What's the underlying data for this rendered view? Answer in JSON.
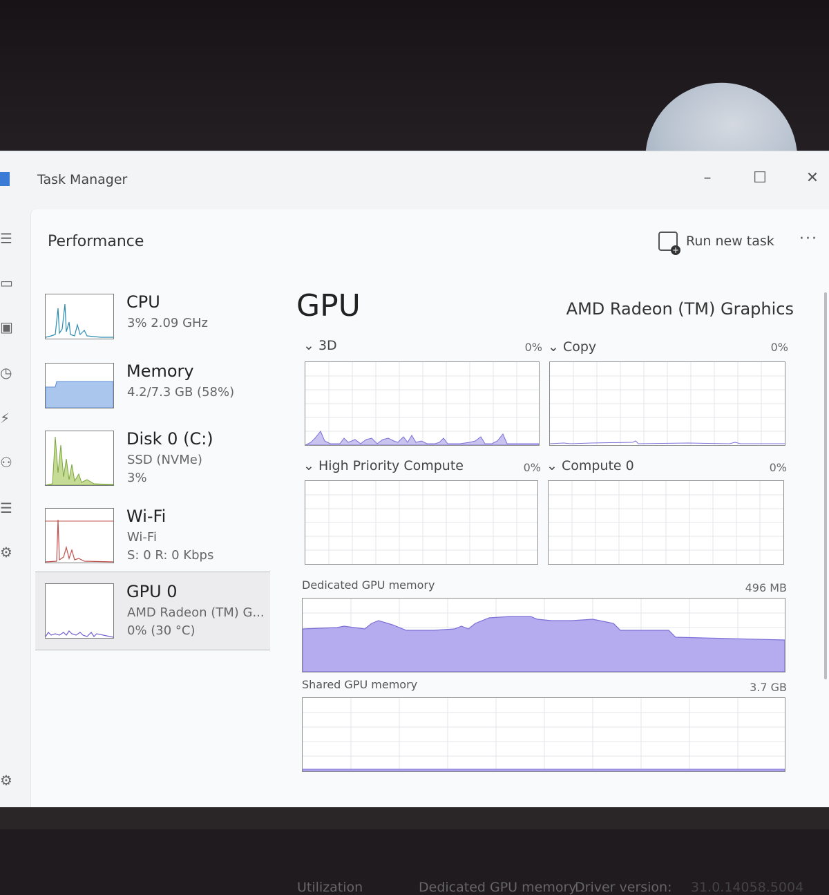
{
  "window": {
    "title": "Task Manager",
    "controls": {
      "minimize": "–",
      "maximize": "☐",
      "close": "✕"
    }
  },
  "header": {
    "page_title": "Performance",
    "run_new_task": "Run new task",
    "more": "···"
  },
  "nav_rail": [
    "menu-icon",
    "processes-icon",
    "performance-icon",
    "history-icon",
    "startup-icon",
    "users-icon",
    "details-icon",
    "services-icon",
    "settings-icon"
  ],
  "resources": [
    {
      "name": "CPU",
      "sub1": "3% 2.09 GHz",
      "sub2": "",
      "color": "#2b8cb1"
    },
    {
      "name": "Memory",
      "sub1": "4.2/7.3 GB (58%)",
      "sub2": "",
      "color": "#5c8fd6"
    },
    {
      "name": "Disk 0 (C:)",
      "sub1": "SSD (NVMe)",
      "sub2": "3%",
      "color": "#7aa43a"
    },
    {
      "name": "Wi-Fi",
      "sub1": "Wi-Fi",
      "sub2": "S: 0 R: 0 Kbps",
      "color": "#c0504d"
    },
    {
      "name": "GPU 0",
      "sub1": "AMD Radeon (TM) G...",
      "sub2": "0% (30 °C)",
      "color": "#6f5fd0"
    }
  ],
  "gpu": {
    "title": "GPU",
    "model": "AMD Radeon (TM) Graphics",
    "engines": [
      {
        "label": "3D",
        "percent": "0%"
      },
      {
        "label": "Copy",
        "percent": "0%"
      },
      {
        "label": "High Priority Compute",
        "percent": "0%"
      },
      {
        "label": "Compute 0",
        "percent": "0%"
      }
    ],
    "dedicated": {
      "label": "Dedicated GPU memory",
      "max": "496 MB"
    },
    "shared": {
      "label": "Shared GPU memory",
      "max": "3.7 GB"
    },
    "footer": {
      "utilization": "Utilization",
      "dedicated": "Dedicated GPU memory",
      "driver_label": "Driver version:",
      "driver_value": "31.0.14058.5004"
    },
    "accent": "#7b6fd8"
  }
}
